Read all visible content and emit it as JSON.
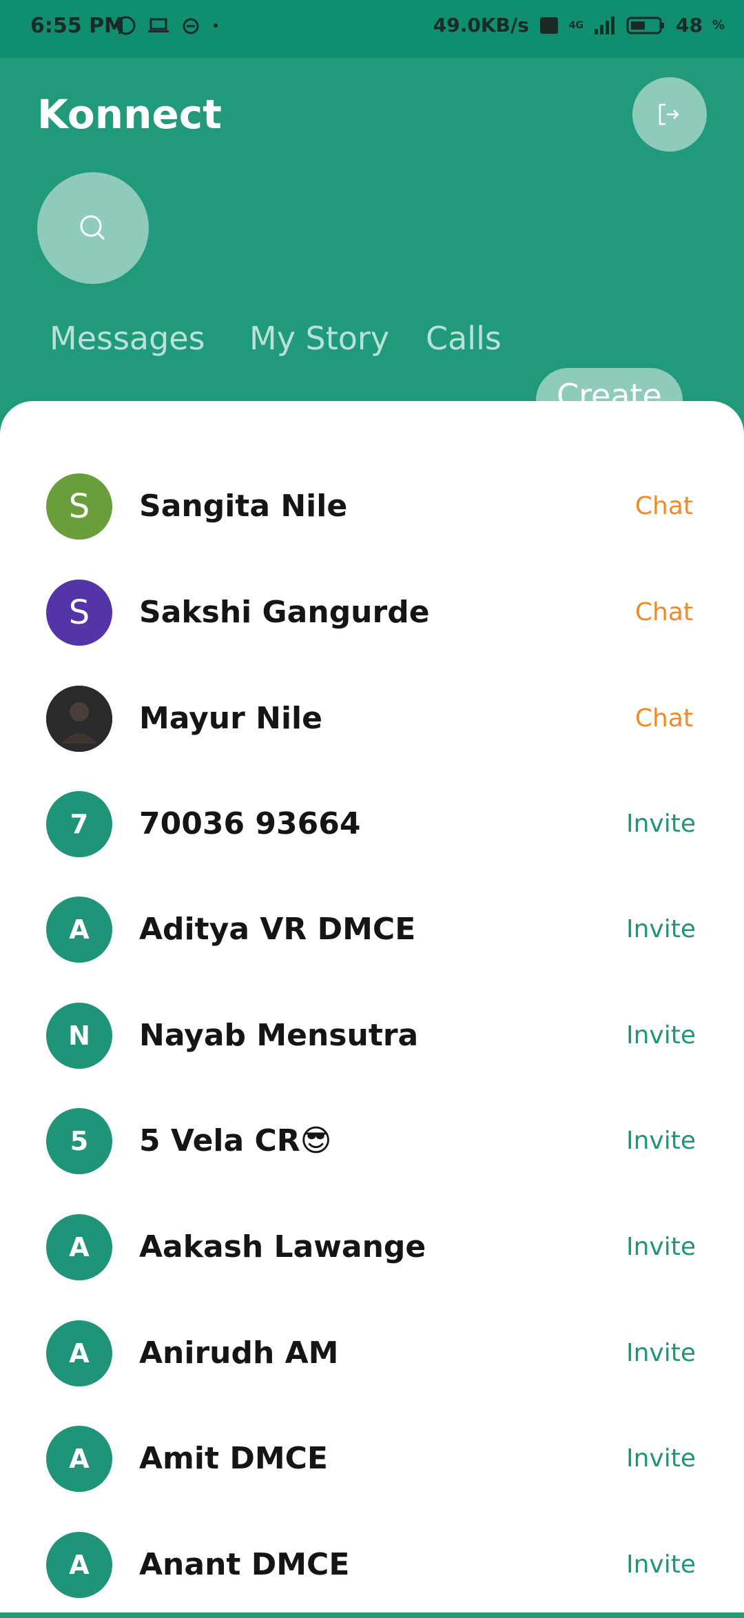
{
  "status": {
    "time": "6:55 PM",
    "speed": "49.0KB/s",
    "network": "4G",
    "battery": "48",
    "battery_unit": "%"
  },
  "header": {
    "title": "Konnect",
    "logout_icon": "logout-icon",
    "search_icon": "search-icon"
  },
  "tabs": [
    {
      "label": "Messages",
      "active": false
    },
    {
      "label": "My Story",
      "active": false
    },
    {
      "label": "Calls",
      "active": false
    },
    {
      "label": "Create",
      "active": true
    }
  ],
  "contacts": [
    {
      "initial": "S",
      "name": "Sangita Nile",
      "action": "Chat",
      "color": "#6a9e3a"
    },
    {
      "initial": "S",
      "name": "Sakshi Gangurde",
      "action": "Chat",
      "color": "#5533a8"
    },
    {
      "initial": "",
      "name": "Mayur Nile",
      "action": "Chat",
      "color": "#2b2b2b"
    },
    {
      "initial": "7",
      "name": "70036 93664",
      "action": "Invite",
      "color": "#1f9478"
    },
    {
      "initial": "A",
      "name": "Aditya VR DMCE",
      "action": "Invite",
      "color": "#1f9478"
    },
    {
      "initial": "N",
      "name": "Nayab Mensutra",
      "action": "Invite",
      "color": "#1f9478"
    },
    {
      "initial": "5",
      "name": "5 Vela CR😎",
      "action": "Invite",
      "color": "#1f9478"
    },
    {
      "initial": "A",
      "name": "Aakash Lawange",
      "action": "Invite",
      "color": "#1f9478"
    },
    {
      "initial": "A",
      "name": "Anirudh AM",
      "action": "Invite",
      "color": "#1f9478"
    },
    {
      "initial": "A",
      "name": "Amit DMCE",
      "action": "Invite",
      "color": "#1f9478"
    },
    {
      "initial": "A",
      "name": "Anant DMCE",
      "action": "Invite",
      "color": "#1f9478"
    }
  ]
}
